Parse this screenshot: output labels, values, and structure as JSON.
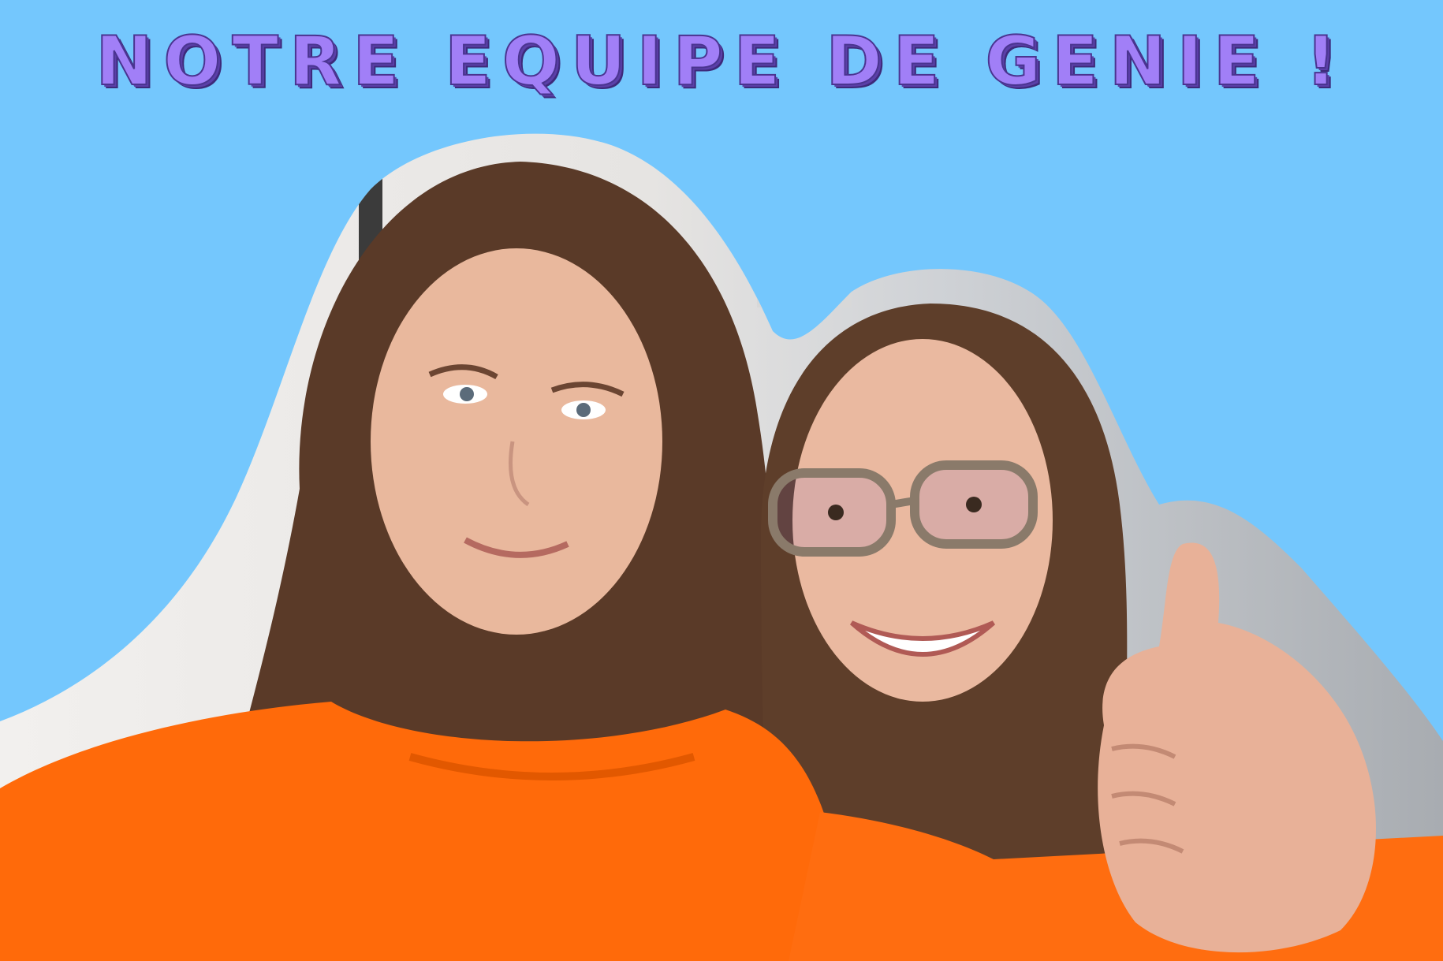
{
  "title": "NOTRE EQUIPE DE GENIE !",
  "colors": {
    "background": "#74c7fd",
    "title": "#a17ff7",
    "shirt": "#ff6a0a",
    "hair": "#5a3a28",
    "skin": "#e7b79e",
    "blob_backdrop": "#e9edf2"
  }
}
